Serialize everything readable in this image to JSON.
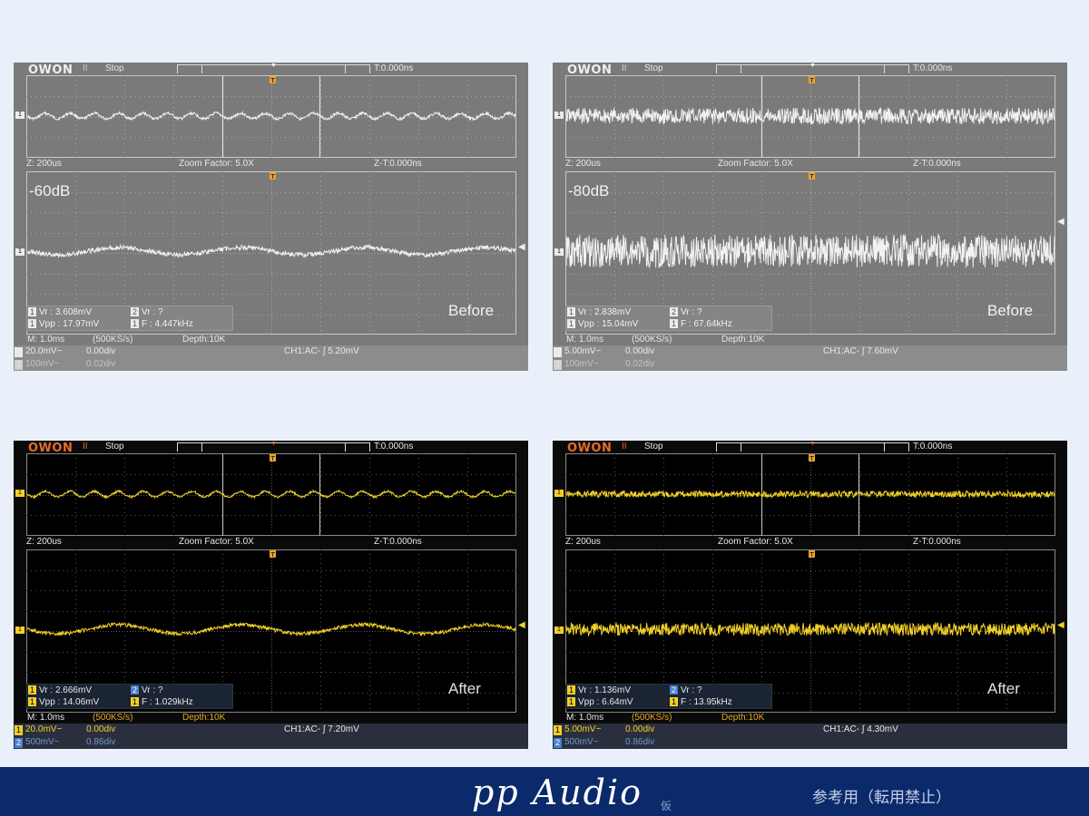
{
  "scopes": [
    {
      "id": "tl",
      "theme": "gray",
      "logo": "OWON",
      "run_indicator": "II",
      "run_state": "Stop",
      "trigger_pos": "T:0.000ns",
      "zoom": {
        "z": "Z: 200us",
        "factor": "Zoom Factor: 5.0X",
        "zt": "Z-T:0.000ns"
      },
      "attenuation_label": "-60dB",
      "stage_label": "Before",
      "measurements": {
        "vr1": "Vr : 3.608mV",
        "vr2": "Vr :     ?",
        "vpp1": "Vpp : 17.97mV",
        "f1": "F : 4.447kHz"
      },
      "status": {
        "timebase": "M: 1.0ms",
        "rate": "(500KS/s)",
        "depth": "Depth:10K"
      },
      "ch1": {
        "volts": "20.0mV~",
        "offset": "0.00div",
        "trigger": "CH1:AC- ∫ 5.20mV"
      },
      "ch2": {
        "volts": "100mV~",
        "offset": "0.02div"
      }
    },
    {
      "id": "tr",
      "theme": "gray",
      "logo": "OWON",
      "run_indicator": "II",
      "run_state": "Stop",
      "trigger_pos": "T:0.000ns",
      "zoom": {
        "z": "Z: 200us",
        "factor": "Zoom Factor: 5.0X",
        "zt": "Z-T:0.000ns"
      },
      "attenuation_label": "-80dB",
      "stage_label": "Before",
      "measurements": {
        "vr1": "Vr : 2.838mV",
        "vr2": "Vr :     ?",
        "vpp1": "Vpp : 15.04mV",
        "f1": "F : 67.64kHz"
      },
      "status": {
        "timebase": "M: 1.0ms",
        "rate": "(500KS/s)",
        "depth": "Depth:10K"
      },
      "ch1": {
        "volts": "5.00mV~",
        "offset": "0.00div",
        "trigger": "CH1:AC- ∫ 7.60mV"
      },
      "ch2": {
        "volts": "100mV~",
        "offset": "0.02div"
      }
    },
    {
      "id": "bl",
      "theme": "dark",
      "logo": "OWON",
      "run_indicator": "II",
      "run_state": "Stop",
      "trigger_pos": "T:0.000ns",
      "zoom": {
        "z": "Z: 200us",
        "factor": "Zoom Factor: 5.0X",
        "zt": "Z-T:0.000ns"
      },
      "attenuation_label": "",
      "stage_label": "After",
      "measurements": {
        "vr1": "Vr : 2.666mV",
        "vr2": "Vr :     ?",
        "vpp1": "Vpp : 14.06mV",
        "f1": "F : 1.029kHz"
      },
      "status": {
        "timebase": "M: 1.0ms",
        "rate": "(500KS/s)",
        "depth": "Depth:10K"
      },
      "ch1": {
        "volts": "20.0mV~",
        "offset": "0.00div",
        "trigger": "CH1:AC- ∫ 7.20mV"
      },
      "ch2": {
        "volts": "500mV~",
        "offset": "0.86div"
      }
    },
    {
      "id": "br",
      "theme": "dark",
      "logo": "OWON",
      "run_indicator": "II",
      "run_state": "Stop",
      "trigger_pos": "T:0.000ns",
      "zoom": {
        "z": "Z: 200us",
        "factor": "Zoom Factor: 5.0X",
        "zt": "Z-T:0.000ns"
      },
      "attenuation_label": "",
      "stage_label": "After",
      "measurements": {
        "vr1": "Vr : 1.136mV",
        "vr2": "Vr :     ?",
        "vpp1": "Vpp : 6.64mV",
        "f1": "F : 13.95kHz"
      },
      "status": {
        "timebase": "M: 1.0ms",
        "rate": "(500KS/s)",
        "depth": "Depth:10K"
      },
      "ch1": {
        "volts": "5.00mV~",
        "offset": "0.00div",
        "trigger": "CH1:AC- ∫ 4.30mV"
      },
      "ch2": {
        "volts": "500mV~",
        "offset": "0.86div"
      }
    }
  ],
  "badges": {
    "one": "1",
    "two": "2"
  },
  "footer": {
    "brand": "pp Audio",
    "kari": "仮",
    "note": "参考用（転用禁止）"
  },
  "colors": {
    "gray_trace": "#f2f2f2",
    "yellow_trace": "#f2d027",
    "footer_bg": "#0b2a6c"
  }
}
